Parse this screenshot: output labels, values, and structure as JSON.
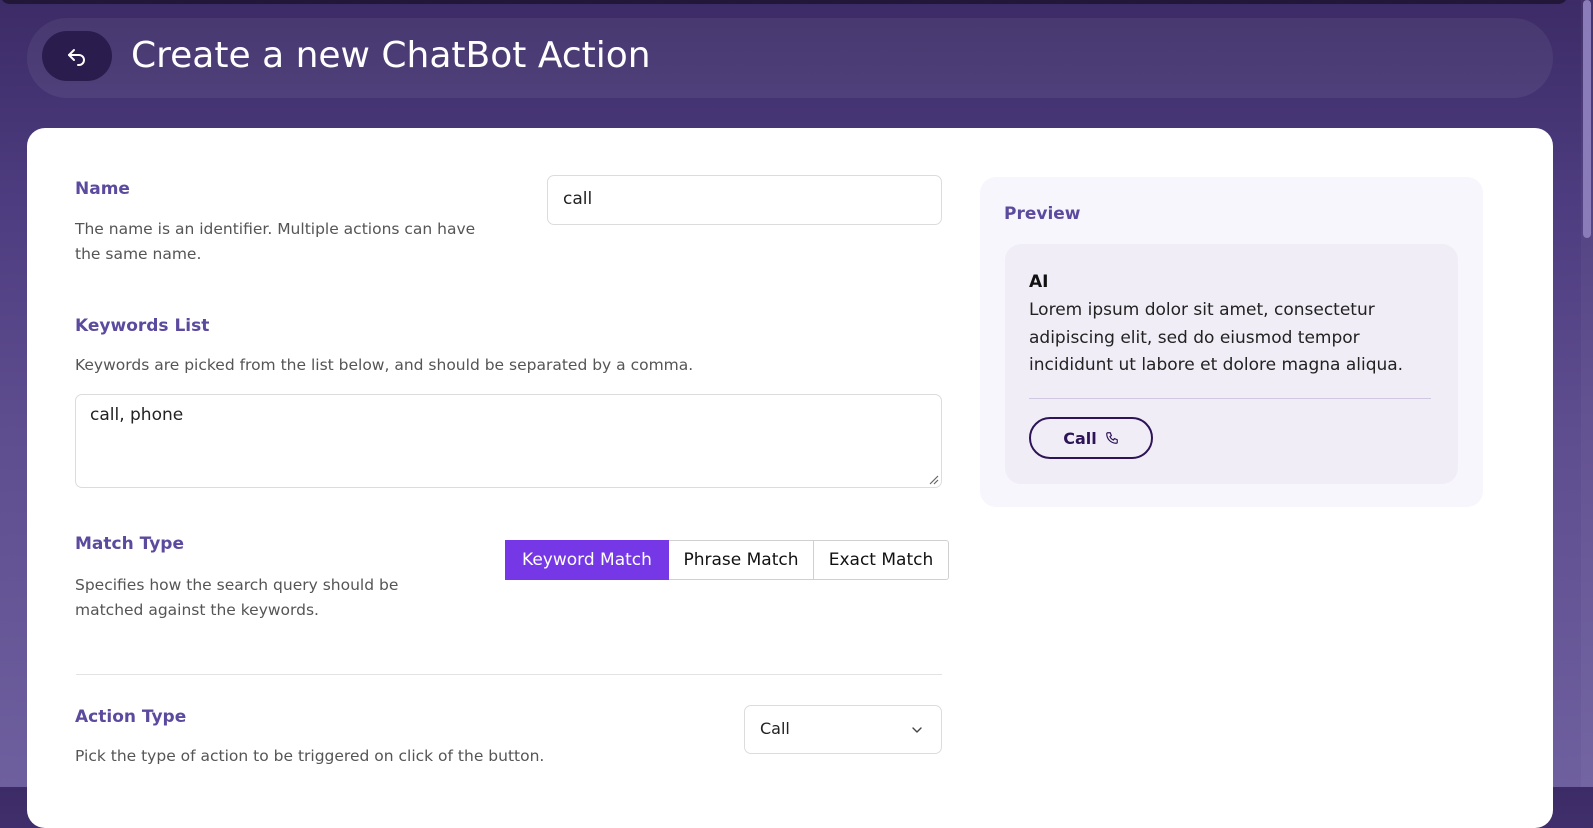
{
  "header": {
    "back_icon": "reply-arrow-icon",
    "title": "Create a new ChatBot Action"
  },
  "form": {
    "name": {
      "label": "Name",
      "description_line1": "The name is an identifier. Multiple actions can have",
      "description_line2": "the same name.",
      "value": "call"
    },
    "keywords": {
      "label": "Keywords List",
      "description": "Keywords are picked from the list below, and should be separated by a comma.",
      "value": "call, phone"
    },
    "match_type": {
      "label": "Match Type",
      "description_line1": "Specifies how the search query should be",
      "description_line2": "matched against the keywords.",
      "options": [
        "Keyword Match",
        "Phrase Match",
        "Exact Match"
      ],
      "selected": "Keyword Match"
    },
    "action_type": {
      "label": "Action Type",
      "description": "Pick the type of action to be triggered on click of the button.",
      "value": "Call",
      "dropdown_icon": "chevron-down-icon"
    }
  },
  "preview": {
    "title": "Preview",
    "sender": "AI",
    "message": "Lorem ipsum dolor sit amet, consectetur adipiscing elit, sed do eiusmod tempor incididunt ut labore et dolore magna aliqua.",
    "button_label": "Call",
    "button_icon": "phone-icon"
  },
  "colors": {
    "accent": "#7637e6",
    "label": "#5c4a9e",
    "header_bg": "#3c2b66",
    "back_button_bg": "#2a1c4c",
    "call_button_border": "#2d1457"
  }
}
